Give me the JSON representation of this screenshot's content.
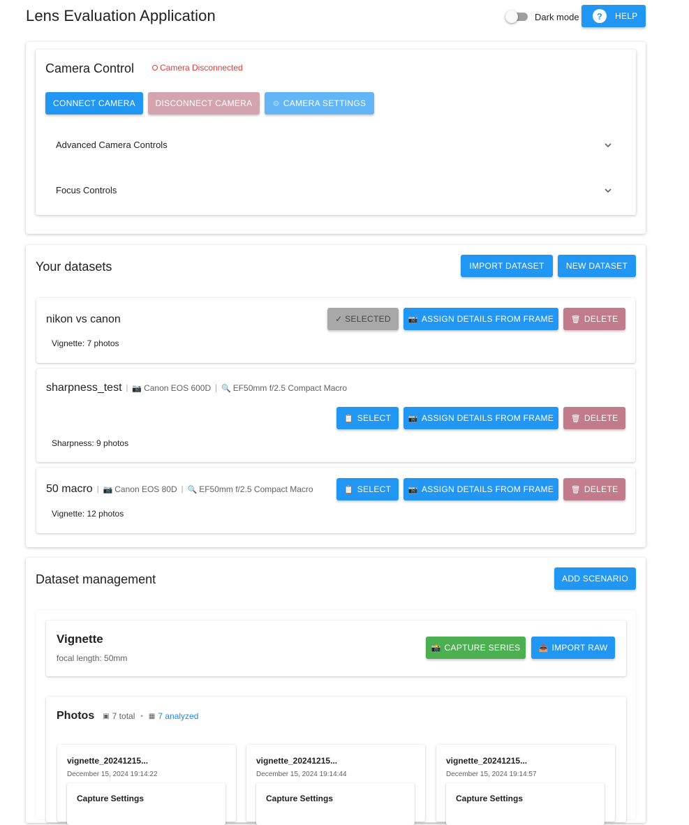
{
  "header": {
    "title": "Lens Evaluation Application",
    "dark_mode_label": "Dark mode",
    "help_label": "HELP"
  },
  "camera_control": {
    "title": "Camera Control",
    "status": "Camera Disconnected",
    "connect_label": "CONNECT CAMERA",
    "disconnect_label": "DISCONNECT CAMERA",
    "settings_label": "CAMERA SETTINGS",
    "advanced_label": "Advanced Camera Controls",
    "focus_label": "Focus Controls"
  },
  "datasets": {
    "title": "Your datasets",
    "import_label": "IMPORT DATASET",
    "new_label": "NEW DATASET",
    "assign_label": "ASSIGN DETAILS FROM FRAME",
    "delete_label": "DELETE",
    "select_label": "SELECT",
    "selected_label": "✓ SELECTED",
    "items": [
      {
        "name": "nikon vs canon",
        "camera": "",
        "lens": "",
        "summary": "Vignette: 7 photos"
      },
      {
        "name": "sharpness_test",
        "camera": "Canon EOS 600D",
        "lens": "EF50mm f/2.5 Compact Macro",
        "summary": "Sharpness: 9 photos"
      },
      {
        "name": "50 macro",
        "camera": "Canon EOS 80D",
        "lens": "EF50mm f/2.5 Compact Macro",
        "summary": "Vignette: 12 photos"
      }
    ]
  },
  "management": {
    "title": "Dataset management",
    "add_scenario_label": "ADD SCENARIO",
    "scenario": {
      "name": "Vignette",
      "focal": "focal length: 50mm",
      "capture_label": "CAPTURE SERIES",
      "import_raw_label": "IMPORT RAW"
    },
    "photos": {
      "title": "Photos",
      "total": "7 total",
      "analyzed": "7 analyzed",
      "items": [
        {
          "name": "vignette_20241215...",
          "date": "December 15, 2024 19:14:22",
          "settings": "Capture Settings"
        },
        {
          "name": "vignette_20241215...",
          "date": "December 15, 2024 19:14:44",
          "settings": "Capture Settings"
        },
        {
          "name": "vignette_20241215...",
          "date": "December 15, 2024 19:14:57",
          "settings": "Capture Settings"
        }
      ]
    }
  },
  "colors": {
    "primary": "#2196f3",
    "danger_text": "#e53935",
    "success": "#4caf50",
    "rose": "#c27b8b"
  }
}
